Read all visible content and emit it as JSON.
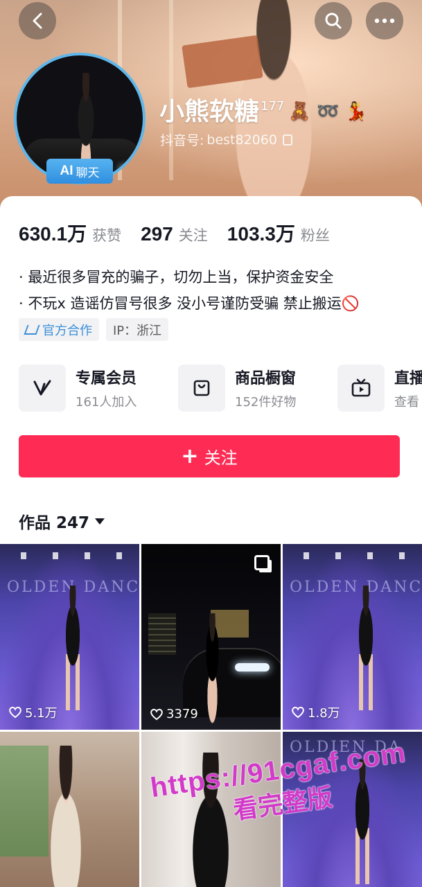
{
  "header": {
    "nickname": "小熊软糖",
    "nickname_sup": "177",
    "nickname_emoji": "🧸 ➿ 💃",
    "douyin_id_label": "抖音号:",
    "douyin_id": "best82060",
    "ai_badge_ai": "AI",
    "ai_badge_chat": "聊天"
  },
  "stats": {
    "likes_value": "630.1万",
    "likes_label": "获赞",
    "following_value": "297",
    "following_label": "关注",
    "followers_value": "103.3万",
    "followers_label": "粉丝"
  },
  "bio": {
    "line1": "· 最近很多冒充的骗子，切勿上当，保护资金安全",
    "line2": "· 不玩x 造谣仿冒号很多 没小号谨防受骗 禁止搬运🚫"
  },
  "tags": {
    "official": "官方合作",
    "ip": "IP：浙江"
  },
  "entries": [
    {
      "title": "专属会员",
      "sub": "161人加入"
    },
    {
      "title": "商品橱窗",
      "sub": "152件好物"
    },
    {
      "title": "直播",
      "sub": "查看"
    }
  ],
  "follow_button": "关注",
  "works": {
    "label": "作品 247"
  },
  "grid": [
    {
      "sign": "OLDEN DANCE",
      "likes": "5.1万"
    },
    {
      "likes": "3379"
    },
    {
      "sign": "OLDEN DANCE",
      "likes": "1.8万"
    },
    {},
    {},
    {
      "sign": "OLDIEN DA"
    }
  ],
  "watermark": {
    "url": "https://91cgaf.com",
    "cta": "看完整版"
  },
  "colors": {
    "accent": "#fe2c55",
    "official_blue": "#3a8fd8",
    "watermark": "#d23ac9"
  }
}
